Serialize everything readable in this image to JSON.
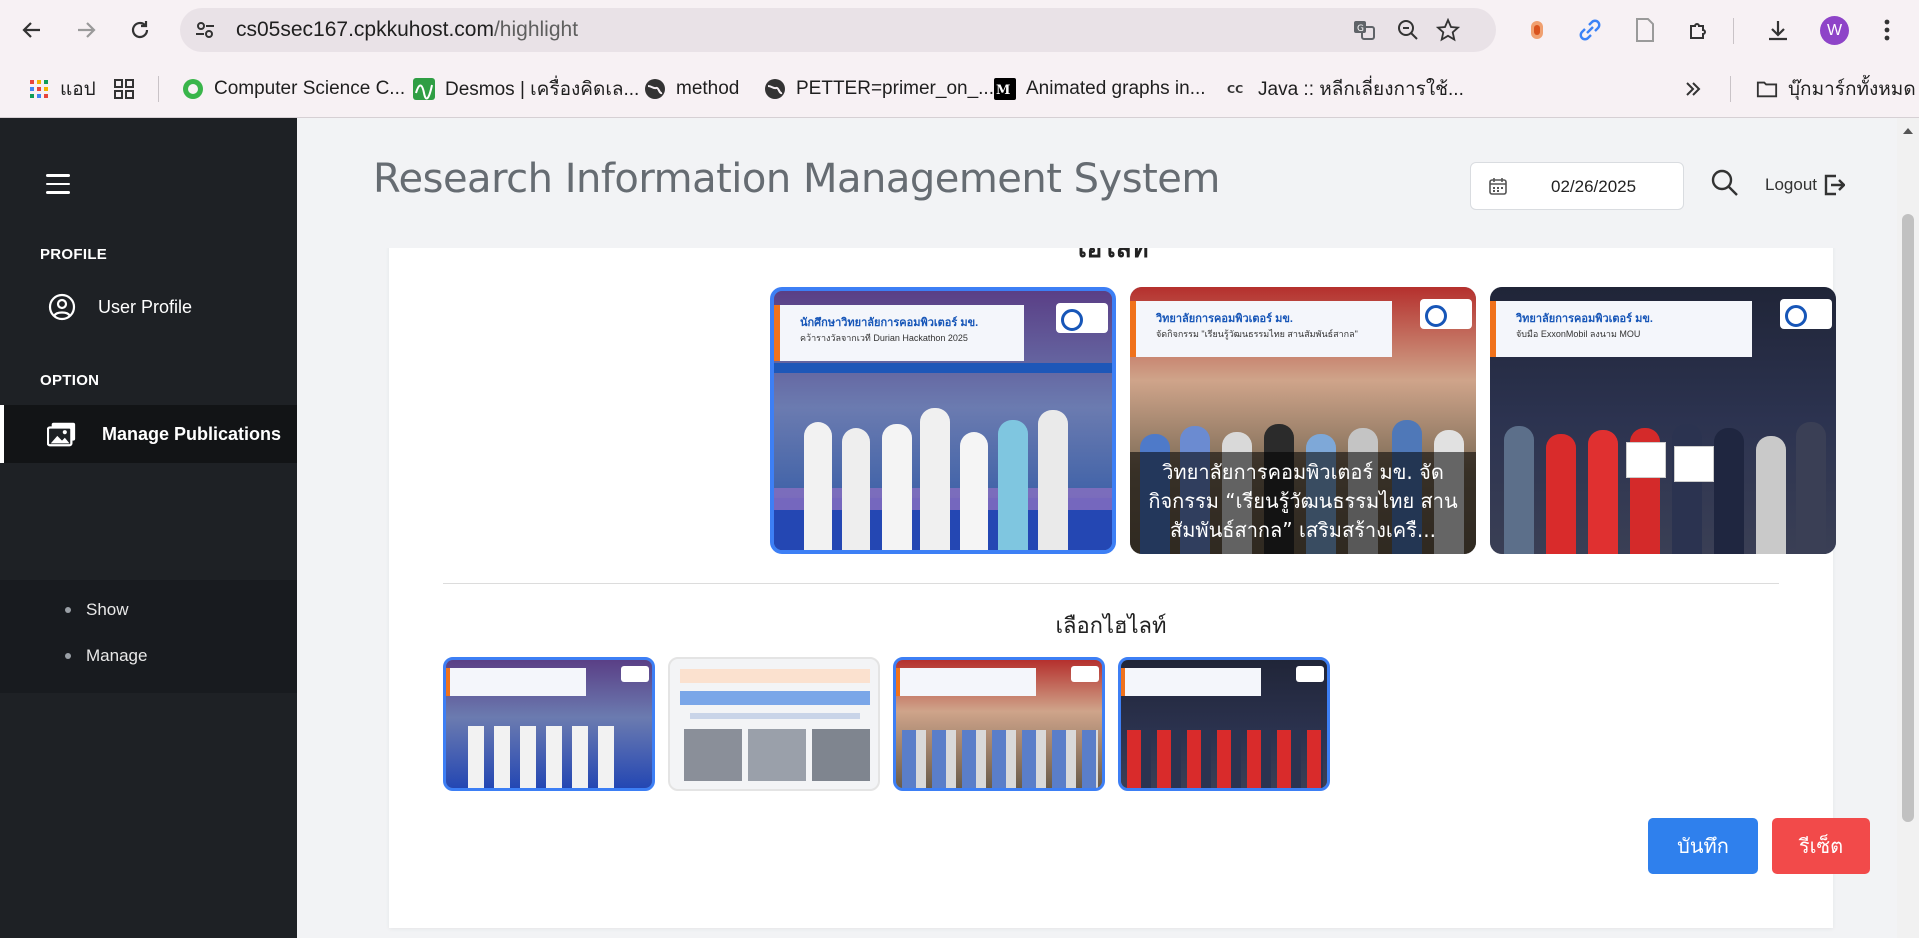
{
  "browser": {
    "url_host": "cs05sec167.cpkkuhost.com",
    "url_path": "/highlight",
    "avatar_letter": "W",
    "bookmarks": [
      {
        "label": "แอป",
        "icon": "apps-grid-icon"
      },
      {
        "label": "Computer Science C...",
        "icon": "site-favicon-icon"
      },
      {
        "label": "Desmos | เครื่องคิดเล...",
        "icon": "desmos-icon"
      },
      {
        "label": "method",
        "icon": "globe-icon"
      },
      {
        "label": "PETTER=primer_on_...",
        "icon": "globe-icon"
      },
      {
        "label": "Animated graphs in...",
        "icon": "medium-icon"
      },
      {
        "label": "Java :: หลีกเลี่ยงการใช้...",
        "icon": "cc-icon"
      }
    ],
    "all_bookmarks_label": "บุ๊กมาร์กทั้งหมด"
  },
  "sidebar": {
    "profile_heading": "PROFILE",
    "user_profile": "User Profile",
    "option_heading": "OPTION",
    "manage_publications": "Manage Publications",
    "sub_items": [
      "Show",
      "Manage"
    ]
  },
  "header": {
    "title": "Research Information Management System",
    "date": "02/26/2025",
    "logout": "Logout"
  },
  "content": {
    "heading": "ไฮไลท์",
    "highlights": [
      {
        "banner_title": "นักศึกษาวิทยาลัยการคอมพิวเตอร์ มข.",
        "banner_sub": "คว้ารางวัลจากเวที Durian Hackathon 2025",
        "selected": true
      },
      {
        "banner_title": "วิทยาลัยการคอมพิวเตอร์ มข.",
        "banner_sub": "จัดกิจกรรม \"เรียนรู้วัฒนธรรมไทย สานสัมพันธ์สากล\"",
        "caption": "วิทยาลัยการคอมพิวเตอร์ มข. จัดกิจกรรม “เรียนรู้วัฒนธรรมไทย สานสัมพันธ์สากล” เสริมสร้างเครื...",
        "selected": false
      },
      {
        "banner_title": "วิทยาลัยการคอมพิวเตอร์ มข.",
        "banner_sub": "จับมือ ExxonMobil ลงนาม MOU",
        "selected": false
      }
    ],
    "choose_label": "เลือกไฮไลท์",
    "thumbnails": [
      {
        "selected": true
      },
      {
        "selected": false
      },
      {
        "selected": true
      },
      {
        "selected": true
      }
    ],
    "save_button": "บันทึก",
    "reset_button": "รีเซ็ต"
  },
  "colors": {
    "sidebar_bg": "#1e2125",
    "accent_blue": "#2f80ed",
    "reset_red": "#f24a4a",
    "selected_border": "#3d7ff5"
  }
}
